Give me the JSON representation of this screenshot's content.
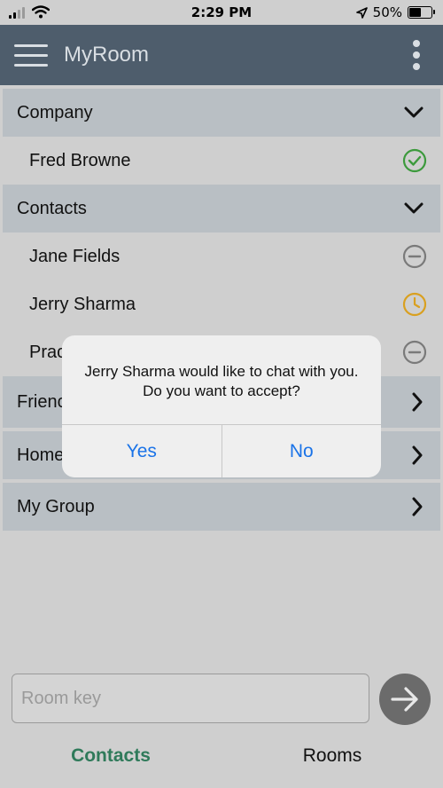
{
  "status_bar": {
    "time": "2:29 PM",
    "battery": "50%",
    "battery_level": 0.5
  },
  "app_bar": {
    "title": "MyRoom"
  },
  "list": {
    "company": {
      "label": "Company",
      "members": [
        "Fred Browne"
      ]
    },
    "contacts": {
      "label": "Contacts",
      "members": [
        "Jane Fields",
        "Jerry Sharma",
        "Prac"
      ]
    },
    "friends": {
      "label": "Frienc"
    },
    "home": {
      "label": "Home"
    },
    "my_group": {
      "label": "My Group"
    }
  },
  "icons": {
    "online": "check-circle-icon",
    "busy": "minus-circle-icon",
    "away": "clock-icon"
  },
  "colors": {
    "app_bar": "#4e5d6c",
    "online": "#3c9a3c",
    "away": "#d9a020",
    "busy": "#7a7a7a",
    "active_tab": "#2f7a5a",
    "link_blue": "#1a73e8"
  },
  "input": {
    "placeholder": "Room key",
    "value": ""
  },
  "tabs": {
    "contacts": "Contacts",
    "rooms": "Rooms"
  },
  "dialog": {
    "message": "Jerry Sharma would like to chat with you.  Do you want to accept?",
    "yes": "Yes",
    "no": "No"
  }
}
